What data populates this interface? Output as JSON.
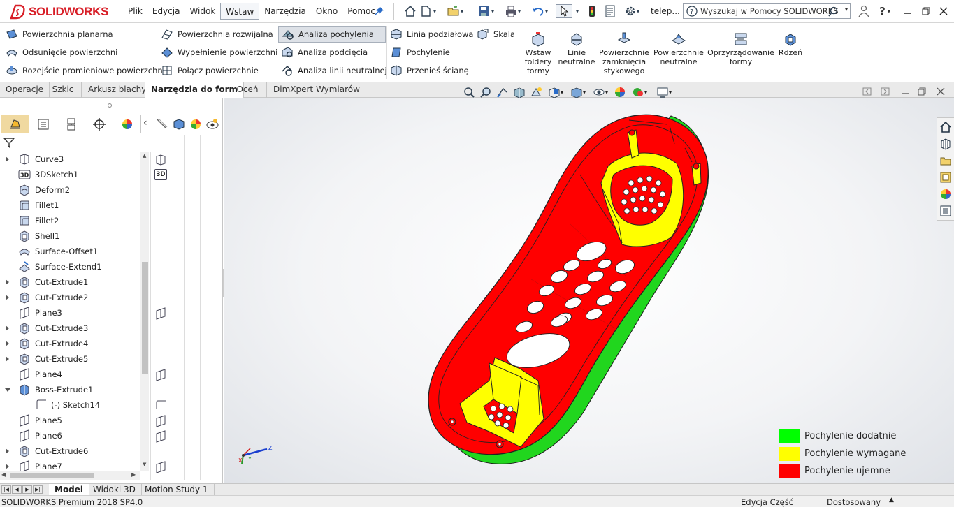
{
  "app": {
    "brand": "SOLIDWORKS"
  },
  "menu": [
    "Plik",
    "Edycja",
    "Widok",
    "Wstaw",
    "Narzędzia",
    "Okno",
    "Pomoc"
  ],
  "menu_active": "Wstaw",
  "quick": {
    "doc_name": "telep..."
  },
  "search": {
    "placeholder": "Wyszukaj w Pomocy SOLIDWORKS"
  },
  "ribbon": {
    "col1": [
      "Powierzchnia planarna",
      "Odsunięcie powierzchni",
      "Rozejście promieniowe powierzchni"
    ],
    "col2": [
      "Powierzchnia rozwijalna",
      "Wypełnienie powierzchni",
      "Połącz powierzchnie"
    ],
    "col3": [
      "Analiza pochylenia",
      "Analiza podcięcia",
      "Analiza linii neutralnej"
    ],
    "col4": [
      "Linia podziałowa",
      "Pochylenie",
      "Przenieś ścianę"
    ],
    "col5": [
      "Skala"
    ],
    "big": [
      "Wstaw foldery formy",
      "Linie neutralne",
      "Powierzchnie zamknięcia stykowego",
      "Powierzchnie neutralne",
      "Oprzyrządowanie formy",
      "Rdzeń"
    ]
  },
  "tabs": [
    "Operacje",
    "Szkic",
    "Arkusz blachy",
    "Narzędzia do form",
    "Oceń",
    "DimXpert Wymiarów"
  ],
  "tab_active": "Narzędzia do form",
  "tree": [
    {
      "label": "Curve3",
      "arrow": "closed",
      "icon": "curve-icon"
    },
    {
      "label": "3DSketch1",
      "arrow": "none",
      "icon": "sketch3d-icon"
    },
    {
      "label": "Deform2",
      "arrow": "none",
      "icon": "deform-icon"
    },
    {
      "label": "Fillet1",
      "arrow": "none",
      "icon": "fillet-icon"
    },
    {
      "label": "Fillet2",
      "arrow": "none",
      "icon": "fillet-icon"
    },
    {
      "label": "Shell1",
      "arrow": "none",
      "icon": "shell-icon"
    },
    {
      "label": "Surface-Offset1",
      "arrow": "none",
      "icon": "surface-offset-icon"
    },
    {
      "label": "Surface-Extend1",
      "arrow": "none",
      "icon": "surface-extend-icon"
    },
    {
      "label": "Cut-Extrude1",
      "arrow": "closed",
      "icon": "cut-extrude-icon"
    },
    {
      "label": "Cut-Extrude2",
      "arrow": "closed",
      "icon": "cut-extrude-icon"
    },
    {
      "label": "Plane3",
      "arrow": "none",
      "icon": "plane-icon"
    },
    {
      "label": "Cut-Extrude3",
      "arrow": "closed",
      "icon": "cut-extrude-icon"
    },
    {
      "label": "Cut-Extrude4",
      "arrow": "closed",
      "icon": "cut-extrude-icon"
    },
    {
      "label": "Cut-Extrude5",
      "arrow": "closed",
      "icon": "cut-extrude-icon"
    },
    {
      "label": "Plane4",
      "arrow": "none",
      "icon": "plane-icon"
    },
    {
      "label": "Boss-Extrude1",
      "arrow": "open",
      "icon": "boss-extrude-icon"
    },
    {
      "label": "(-) Sketch14",
      "arrow": "none",
      "icon": "sketch-icon",
      "sub": true
    },
    {
      "label": "Plane5",
      "arrow": "none",
      "icon": "plane-icon"
    },
    {
      "label": "Plane6",
      "arrow": "none",
      "icon": "plane-icon"
    },
    {
      "label": "Cut-Extrude6",
      "arrow": "closed",
      "icon": "cut-extrude-icon"
    },
    {
      "label": "Plane7",
      "arrow": "closed",
      "icon": "plane-icon"
    }
  ],
  "subcol_labels": {
    "sketch3d": "3D"
  },
  "legend": [
    {
      "label": "Pochylenie dodatnie",
      "color": "#00ff00"
    },
    {
      "label": "Pochylenie wymagane",
      "color": "#ffff00"
    },
    {
      "label": "Pochylenie ujemne",
      "color": "#ff0000"
    }
  ],
  "triad": {
    "x": "X",
    "y": "Y",
    "z": "Z"
  },
  "bottom_tabs": [
    "Model",
    "Widoki 3D",
    "Motion Study 1"
  ],
  "bottom_active": "Model",
  "status": {
    "left": "SOLIDWORKS Premium 2018 SP4.0",
    "mode": "Edycja Część",
    "custom": "Dostosowany"
  },
  "colors": {
    "brand": "#d81e27",
    "negative": "#ff0000",
    "required": "#ffff00",
    "positive": "#00ff00"
  }
}
